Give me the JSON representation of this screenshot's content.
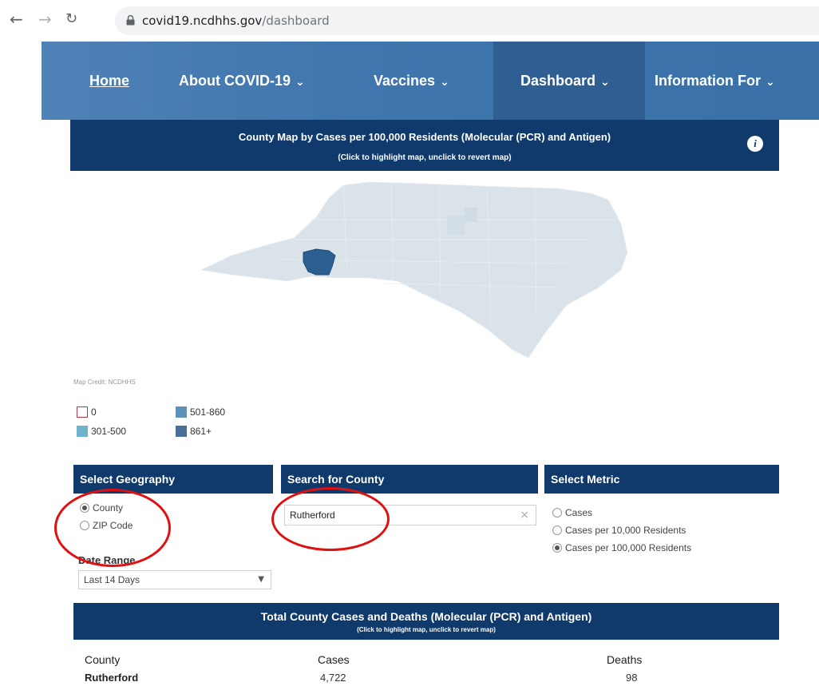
{
  "browser": {
    "domain": "covid19.ncdhhs.gov",
    "path": "/dashboard"
  },
  "nav": {
    "items": [
      {
        "label": "Home"
      },
      {
        "label": "About COVID-19"
      },
      {
        "label": "Vaccines"
      },
      {
        "label": "Dashboard"
      },
      {
        "label": "Information For"
      }
    ],
    "active": "Dashboard"
  },
  "map": {
    "title": "County Map by Cases per 100,000 Residents (Molecular (PCR) and Antigen)",
    "subtitle": "(Click to highlight map, unclick to revert map)",
    "info": "i",
    "credit": "Map Credit: NCDHHS",
    "highlight_color": "#2c5f91",
    "base_color": "#dbe3ea"
  },
  "legend": [
    {
      "label": "0",
      "color": "#ffffff",
      "border": "#b03a48"
    },
    {
      "label": "301-500",
      "color": "#6fb2cc",
      "border": "#6fb2cc"
    },
    {
      "label": "501-860",
      "color": "#5b93b8",
      "border": "#5b93b8"
    },
    {
      "label": "861+",
      "color": "#4a6f97",
      "border": "#4a6f97"
    }
  ],
  "geography": {
    "heading": "Select Geography",
    "options": [
      "County",
      "ZIP Code"
    ],
    "selected": "County"
  },
  "search": {
    "heading": "Search for County",
    "value": "Rutherford",
    "clear": "×"
  },
  "metric": {
    "heading": "Select Metric",
    "options": [
      "Cases",
      "Cases per 10,000 Residents",
      "Cases per 100,000 Residents"
    ],
    "selected": "Cases per 100,000 Residents"
  },
  "date_range": {
    "label": "Date Range",
    "value": "Last 14 Days"
  },
  "totals": {
    "title": "Total County Cases and Deaths (Molecular (PCR) and Antigen)",
    "subtitle": "(Click to highlight map, unclick to revert map)",
    "columns": [
      "County",
      "Cases",
      "Deaths"
    ],
    "rows": [
      {
        "county": "Rutherford",
        "cases": "4,722",
        "deaths": "98"
      }
    ]
  },
  "colors": {
    "header_navy": "#0f3a6b",
    "nav_blue": "#3f76ad",
    "annotation_red": "#e01010"
  }
}
